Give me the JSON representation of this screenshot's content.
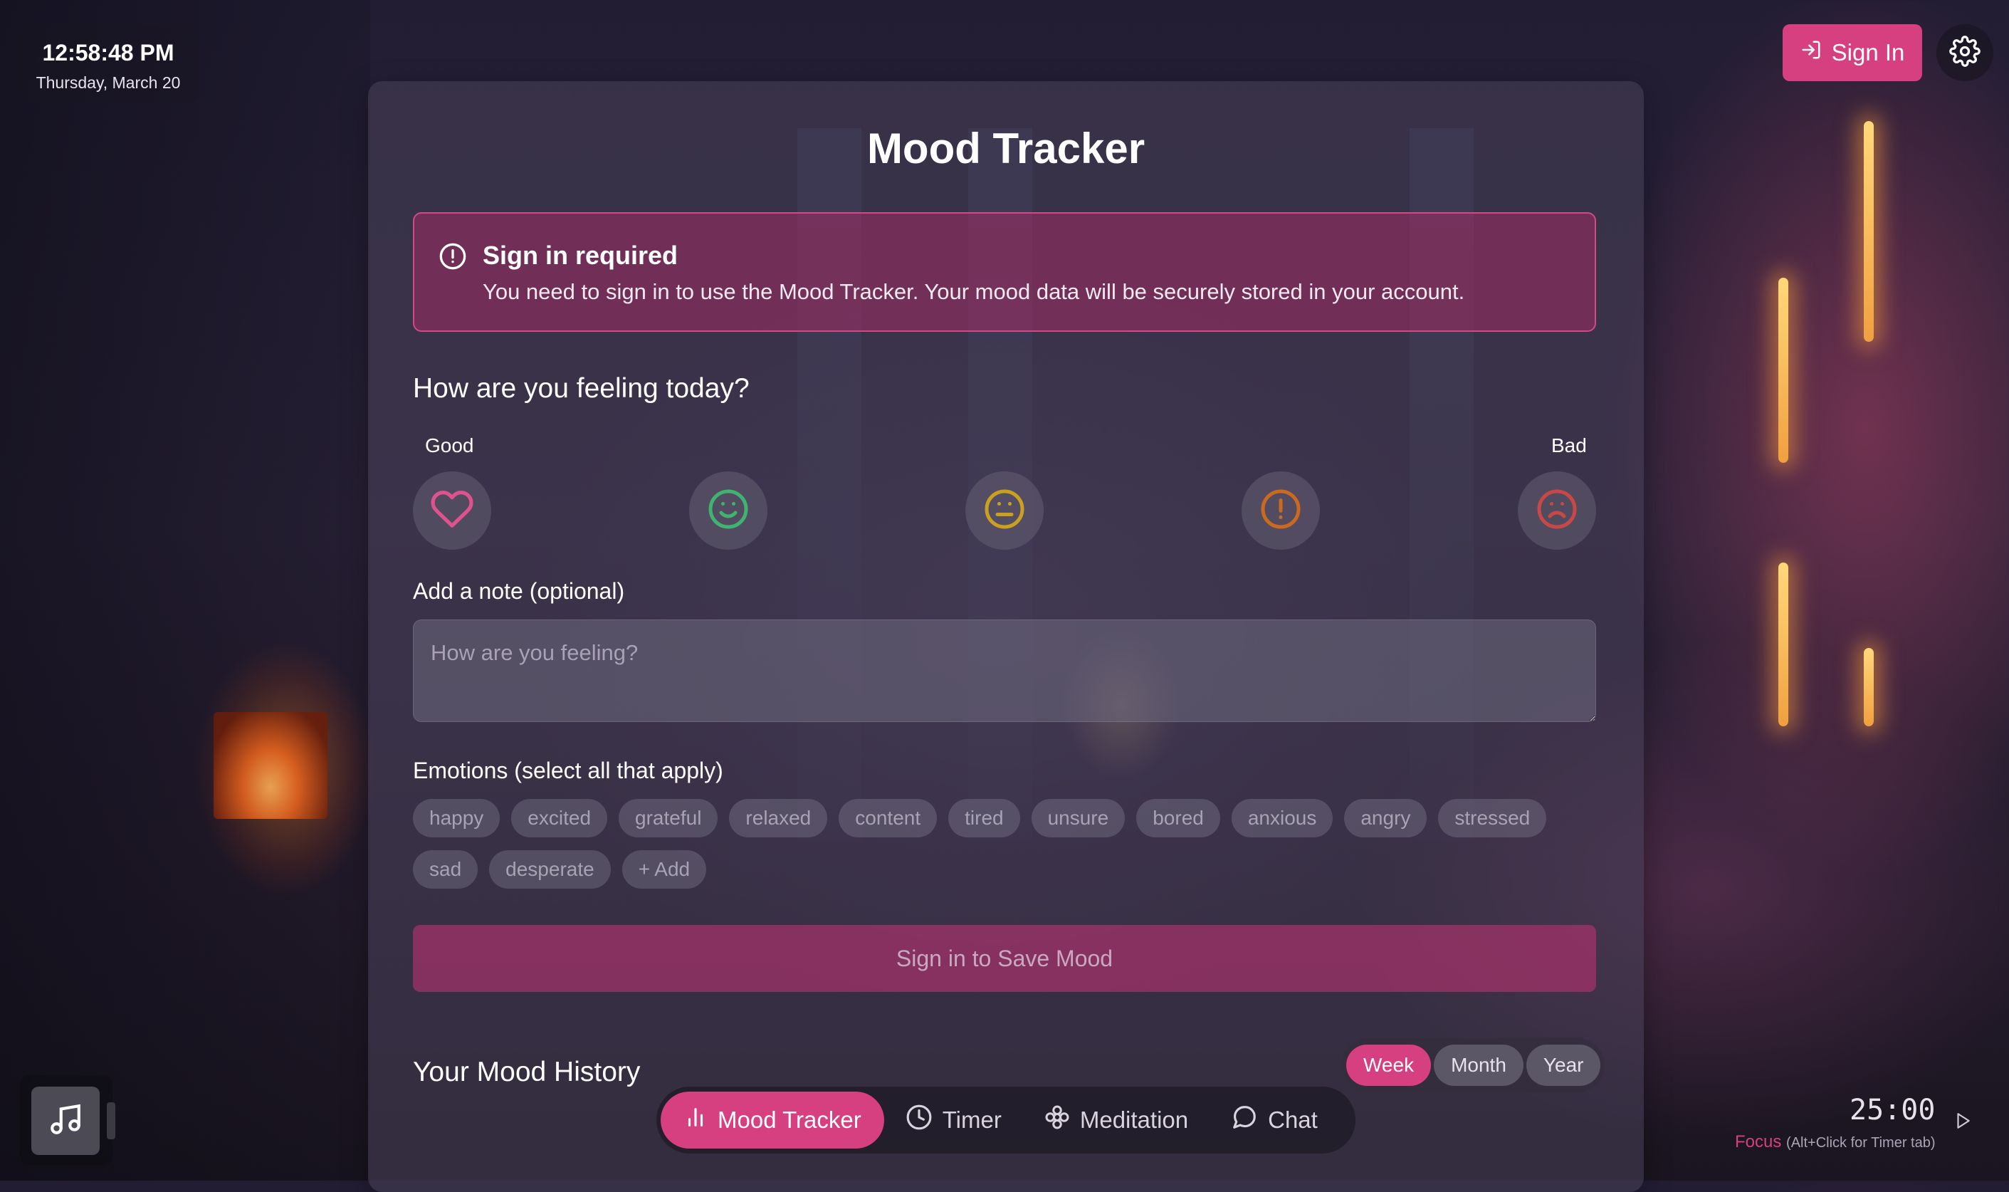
{
  "clock": {
    "time": "12:58:48 PM",
    "date": "Thursday, March 20"
  },
  "header": {
    "sign_in_label": "Sign In",
    "icons": {
      "sign_in": "login-icon",
      "settings": "gear-icon"
    }
  },
  "panel": {
    "title": "Mood Tracker",
    "alert": {
      "title": "Sign in required",
      "message": "You need to sign in to use the Mood Tracker. Your mood data will be securely stored in your account.",
      "icon": "alert-circle-icon"
    },
    "question": "How are you feeling today?",
    "scale": {
      "good_label": "Good",
      "bad_label": "Bad"
    },
    "moods": [
      {
        "name": "great",
        "icon": "heart-icon",
        "color": "#e0528d"
      },
      {
        "name": "good",
        "icon": "smile-icon",
        "color": "#3fb36f"
      },
      {
        "name": "okay",
        "icon": "neutral-face-icon",
        "color": "#c9a020"
      },
      {
        "name": "low",
        "icon": "alert-circle-icon",
        "color": "#c96a20"
      },
      {
        "name": "bad",
        "icon": "frown-icon",
        "color": "#c84848"
      }
    ],
    "note": {
      "label": "Add a note (optional)",
      "placeholder": "How are you feeling?",
      "value": ""
    },
    "emotions": {
      "label": "Emotions (select all that apply)",
      "chips": [
        "happy",
        "excited",
        "grateful",
        "relaxed",
        "content",
        "tired",
        "unsure",
        "bored",
        "anxious",
        "angry",
        "stressed",
        "sad",
        "desperate"
      ],
      "add_label": "+ Add"
    },
    "save_label": "Sign in to Save Mood",
    "history": {
      "title": "Your Mood History",
      "ranges": [
        "Week",
        "Month",
        "Year"
      ],
      "active_range": "Week"
    }
  },
  "bottom_nav": {
    "items": [
      {
        "label": "Mood Tracker",
        "icon": "bar-chart-icon",
        "active": true
      },
      {
        "label": "Timer",
        "icon": "clock-icon",
        "active": false
      },
      {
        "label": "Meditation",
        "icon": "flower-icon",
        "active": false
      },
      {
        "label": "Chat",
        "icon": "chat-bubble-icon",
        "active": false
      }
    ]
  },
  "music": {
    "icon": "music-note-icon"
  },
  "timer": {
    "value": "25:00",
    "mode": "Focus",
    "hint": "(Alt+Click for Timer tab)",
    "play_icon": "play-icon"
  },
  "colors": {
    "accent": "#d63f80",
    "panel": "#48425a"
  }
}
